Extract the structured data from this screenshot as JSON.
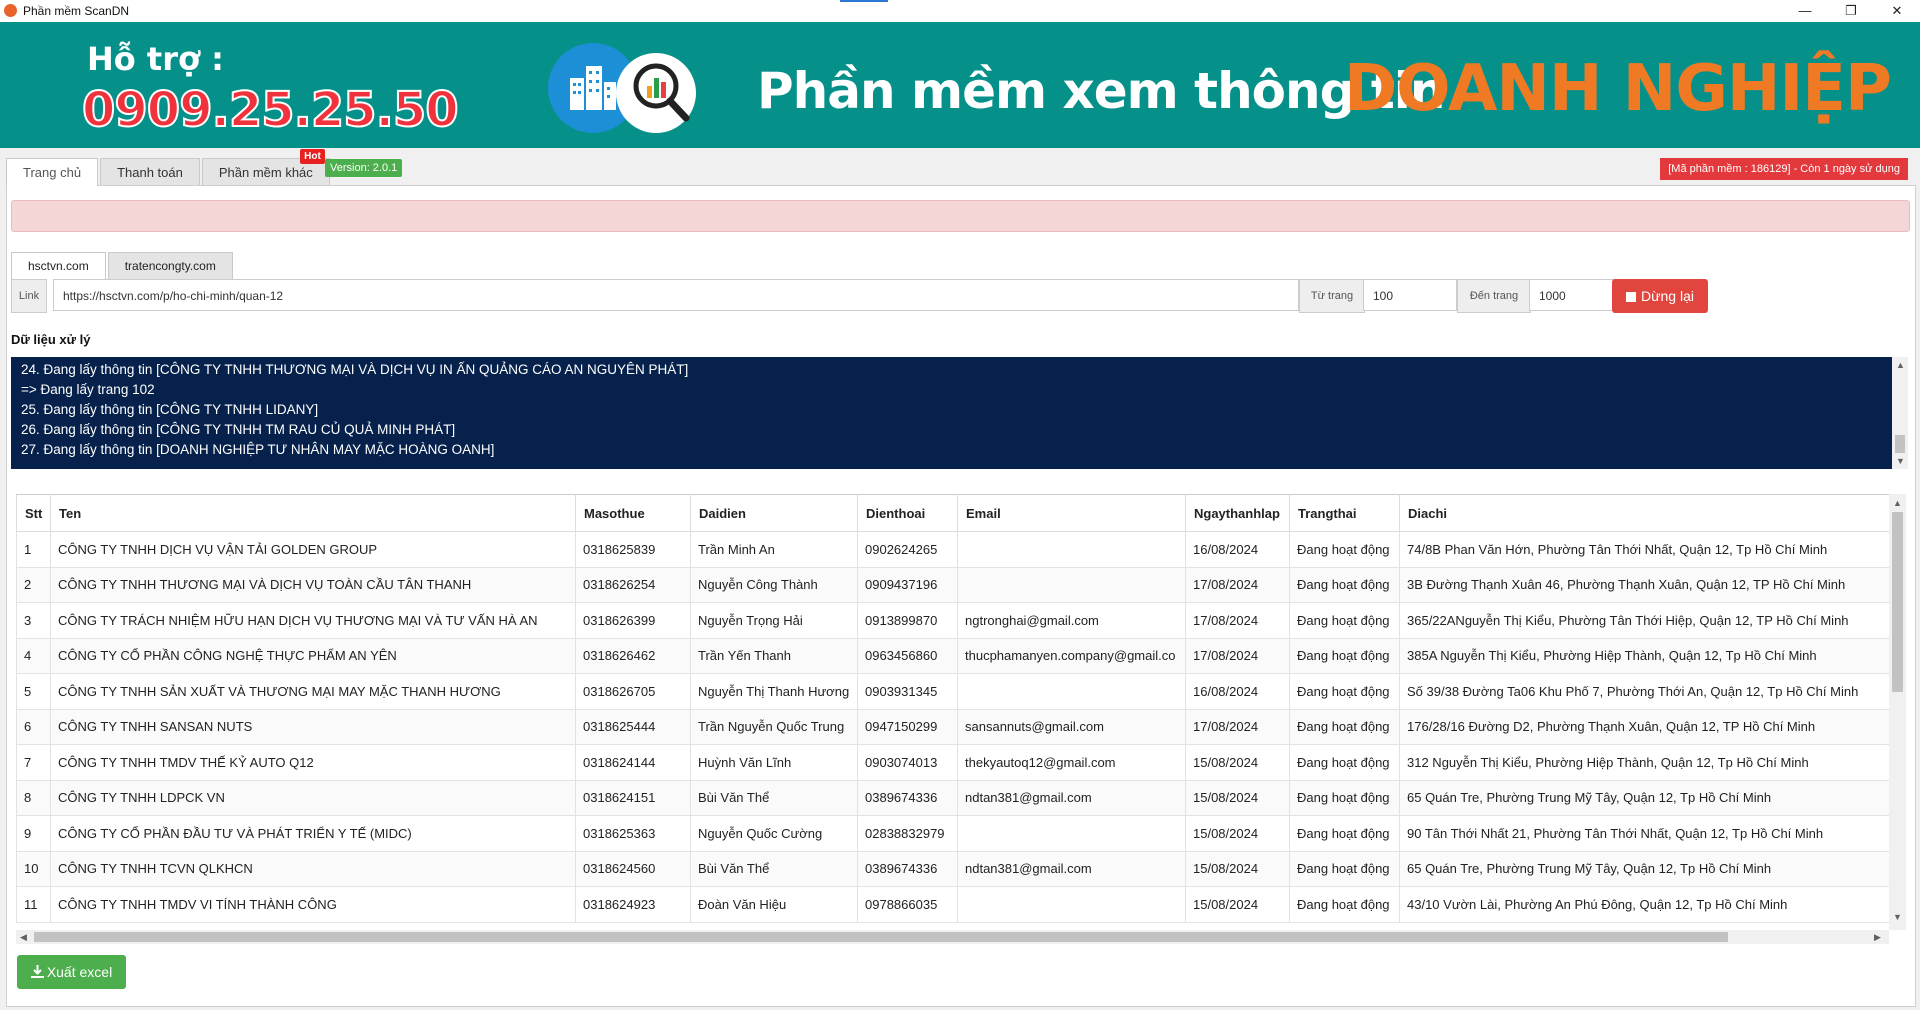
{
  "window": {
    "title": "Phần mềm ScanDN",
    "minimize": "—",
    "maximize": "❐",
    "close": "✕"
  },
  "banner": {
    "support_label": "Hỗ trợ :",
    "phone": "0909.25.25.50",
    "headline": "Phần mềm xem thông tin",
    "highlight": "DOANH NGHIỆP"
  },
  "tabs": [
    {
      "label": "Trang chủ",
      "active": true
    },
    {
      "label": "Thanh toán",
      "active": false
    },
    {
      "label": "Phần mềm khác",
      "active": false,
      "badge": "Hot"
    }
  ],
  "version": "Version: 2.0.1",
  "license": "[Mã phần mềm : 186129] - Còn 1 ngày sử dụng",
  "source_tabs": [
    {
      "label": "hsctvn.com",
      "active": true
    },
    {
      "label": "tratencongty.com",
      "active": false
    }
  ],
  "link_row": {
    "link_label": "Link",
    "link_value": "https://hsctvn.com/p/ho-chi-minh/quan-12",
    "from_label": "Từ trang",
    "from_value": "100",
    "to_label": "Đến trang",
    "to_value": "1000",
    "stop_label": "Dừng lại"
  },
  "log": {
    "label": "Dữ liệu xử lý",
    "lines": [
      "24. Đang lấy thông tin [CÔNG TY TNHH THƯƠNG MẠI VÀ DỊCH VỤ IN ẤN QUẢNG CÁO AN NGUYÊN PHÁT]",
      "=> Đang lấy trang 102",
      "25. Đang lấy thông tin [CÔNG TY TNHH LIDANY]",
      "26. Đang lấy thông tin [CÔNG TY TNHH TM RAU CỦ QUẢ MINH PHÁT]",
      "27. Đang lấy thông tin [DOANH NGHIỆP TƯ NHÂN MAY MẶC HOÀNG OANH]"
    ]
  },
  "table": {
    "columns": [
      "Stt",
      "Ten",
      "Masothue",
      "Daidien",
      "Dienthoai",
      "Email",
      "Ngaythanhlap",
      "Trangthai",
      "Diachi"
    ],
    "rows": [
      [
        "1",
        "CÔNG TY TNHH DỊCH VỤ VẬN TẢI GOLDEN GROUP",
        "0318625839",
        "Trần Minh An",
        "0902624265",
        "",
        "16/08/2024",
        "Đang hoạt động",
        "74/8B Phan Văn Hớn, Phường Tân Thới Nhất, Quận 12, Tp Hồ Chí Minh"
      ],
      [
        "2",
        "CÔNG TY TNHH THƯƠNG MẠI VÀ DỊCH VỤ TOÀN CẦU TÂN THANH",
        "0318626254",
        "Nguyễn Công Thành",
        "0909437196",
        "",
        "17/08/2024",
        "Đang hoạt động",
        "3B Đường Thạnh Xuân 46, Phường Thạnh Xuân, Quận 12, TP Hồ Chí Minh"
      ],
      [
        "3",
        "CÔNG TY TRÁCH NHIỆM HỮU HẠN DỊCH VỤ THƯƠNG MẠI VÀ TƯ VẤN HÀ AN",
        "0318626399",
        "Nguyễn Trọng Hải",
        "0913899870",
        "ngtronghai@gmail.com",
        "17/08/2024",
        "Đang hoạt động",
        "365/22ANguyễn Thị Kiểu, Phường Tân Thới Hiệp, Quận 12, TP Hồ Chí Minh"
      ],
      [
        "4",
        "CÔNG TY CỔ PHẦN CÔNG NGHỆ THỰC PHẨM AN YÊN",
        "0318626462",
        "Trần Yến Thanh",
        "0963456860",
        "thucphamanyen.company@gmail.co",
        "17/08/2024",
        "Đang hoạt động",
        "385A Nguyễn Thị Kiểu, Phường Hiệp Thành, Quận 12, Tp Hồ Chí Minh"
      ],
      [
        "5",
        "CÔNG TY TNHH SẢN XUẤT VÀ THƯƠNG MẠI MAY MẶC THANH HƯƠNG",
        "0318626705",
        "Nguyễn Thị Thanh Hương",
        "0903931345",
        "",
        "16/08/2024",
        "Đang hoạt động",
        "Số 39/38 Đường Ta06 Khu Phố 7, Phường Thới An, Quận 12, Tp Hồ Chí Minh"
      ],
      [
        "6",
        "CÔNG TY TNHH SANSAN NUTS",
        "0318625444",
        "Trần Nguyễn Quốc Trung",
        "0947150299",
        "sansannuts@gmail.com",
        "17/08/2024",
        "Đang hoạt động",
        "176/28/16 Đường D2, Phường Thạnh Xuân, Quận 12, TP Hồ Chí Minh"
      ],
      [
        "7",
        "CÔNG TY TNHH TMDV THẾ KỶ AUTO Q12",
        "0318624144",
        "Huỳnh Văn Lĩnh",
        "0903074013",
        "thekyautoq12@gmail.com",
        "15/08/2024",
        "Đang hoạt động",
        "312 Nguyễn Thị Kiểu, Phường Hiệp Thành, Quận 12, Tp Hồ Chí Minh"
      ],
      [
        "8",
        "CÔNG TY TNHH LDPCK VN",
        "0318624151",
        "Bùi Văn Thể",
        "0389674336",
        "ndtan381@gmail.com",
        "15/08/2024",
        "Đang hoạt động",
        "65 Quán Tre, Phường Trung Mỹ Tây, Quận 12, Tp Hồ Chí Minh"
      ],
      [
        "9",
        "CÔNG TY CỔ PHẦN ĐẦU TƯ VÀ PHÁT TRIỂN Y TẾ (MIDC)",
        "0318625363",
        "Nguyễn Quốc Cường",
        "02838832979",
        "",
        "15/08/2024",
        "Đang hoạt động",
        "90 Tân Thới Nhất 21, Phường Tân Thới Nhất, Quận 12, Tp Hồ Chí Minh"
      ],
      [
        "10",
        "CÔNG TY TNHH TCVN QLKHCN",
        "0318624560",
        "Bùi Văn Thể",
        "0389674336",
        "ndtan381@gmail.com",
        "15/08/2024",
        "Đang hoạt động",
        "65 Quán Tre, Phường Trung Mỹ Tây, Quận 12, Tp Hồ Chí Minh"
      ],
      [
        "11",
        "CÔNG TY TNHH TMDV VI TÍNH THÀNH CÔNG",
        "0318624923",
        "Đoàn Văn Hiệu",
        "0978866035",
        "",
        "15/08/2024",
        "Đang hoạt động",
        "43/10 Vườn Lài, Phường An Phú Đông, Quận 12, Tp Hồ Chí Minh"
      ]
    ]
  },
  "export_label": "Xuất excel",
  "icons": {
    "app": "app-icon",
    "stop": "stop-square-icon",
    "download": "download-icon",
    "logo": "building-magnifier-logo"
  },
  "colors": {
    "banner": "#06908a",
    "phone": "#f0323c",
    "highlight": "#f07a24",
    "log_bg": "#06214b",
    "stop": "#e0463e",
    "export": "#4cae4c"
  }
}
